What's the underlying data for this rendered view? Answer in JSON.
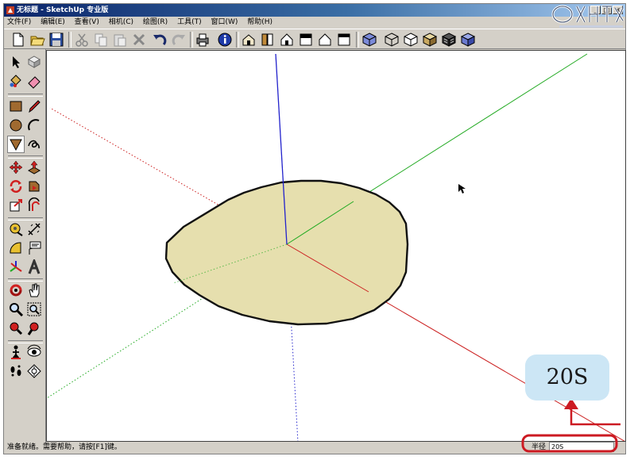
{
  "window": {
    "title": "无标题 - SketchUp 专业版"
  },
  "menu": [
    "文件(F)",
    "编辑(E)",
    "查看(V)",
    "相机(C)",
    "绘图(R)",
    "工具(T)",
    "窗口(W)",
    "帮助(H)"
  ],
  "status": {
    "message": "准备就绪。需要帮助，请按[F1]键。",
    "measure_label": "半径",
    "measure_value": "20S"
  },
  "callout": {
    "text": "20S"
  },
  "colors": {
    "axis_red": "#cc2222",
    "axis_green": "#22aa22",
    "axis_blue": "#2222cc",
    "face": "#e6dfae",
    "highlight": "#cc1a22"
  }
}
